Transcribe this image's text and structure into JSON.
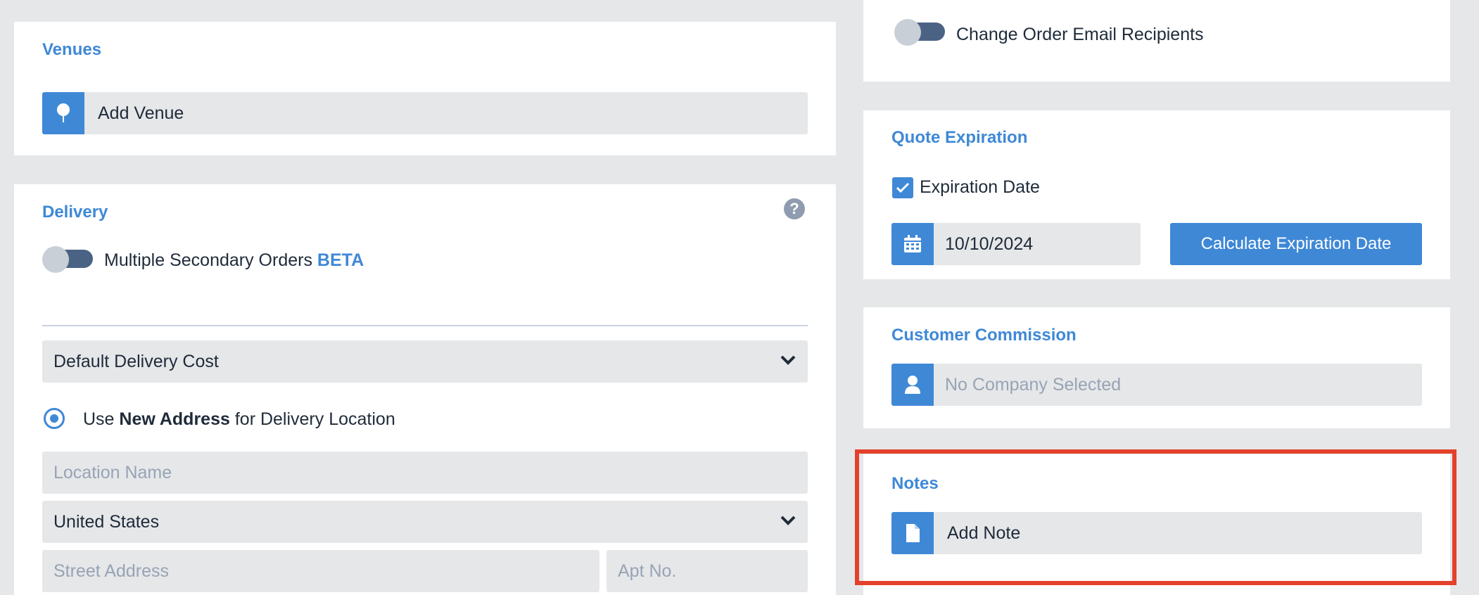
{
  "venues": {
    "title": "Venues",
    "add_label": "Add Venue",
    "icon": "map-pin-icon"
  },
  "delivery": {
    "title": "Delivery",
    "help_icon": "question-circle-icon",
    "toggle_label": "Multiple Secondary Orders",
    "toggle_badge": "BETA",
    "cost_select": "Default Delivery Cost",
    "radio_prefix": "Use",
    "radio_bold": "New Address",
    "radio_suffix": "for Delivery Location",
    "location_placeholder": "Location Name",
    "country": "United States",
    "street_placeholder": "Street Address",
    "apt_placeholder": "Apt No."
  },
  "email_recipients": {
    "toggle_label": "Change Order Email Recipients"
  },
  "quote_expiration": {
    "title": "Quote Expiration",
    "checkbox_label": "Expiration Date",
    "date_value": "10/10/2024",
    "calculate_button": "Calculate Expiration Date",
    "icon": "calendar-icon"
  },
  "commission": {
    "title": "Customer Commission",
    "placeholder": "No Company Selected",
    "icon": "user-icon"
  },
  "notes": {
    "title": "Notes",
    "add_label": "Add Note",
    "icon": "document-icon"
  },
  "colors": {
    "accent": "#3f88d6",
    "background": "#e6e7e9",
    "highlight": "#e3412b",
    "toggle_track": "#4a6385"
  }
}
